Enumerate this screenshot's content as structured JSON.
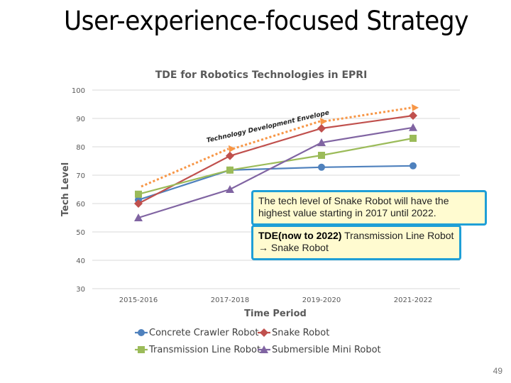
{
  "slide": {
    "title": "User-experience-focused Strategy",
    "page_number": "49"
  },
  "callouts": {
    "first": "The tech level of Snake Robot will have the highest value starting in 2017 until 2022.",
    "second_bold": "TDE(now to 2022)",
    "second_rest": " Transmission Line Robot → Snake Robot"
  },
  "chart_data": {
    "type": "line",
    "title": "TDE for Robotics Technologies in EPRI",
    "xlabel": "Time Period",
    "ylabel": "Tech Level",
    "categories": [
      "2015-2016",
      "2017-2018",
      "2019-2020",
      "2021-2022"
    ],
    "ylim": [
      30,
      100
    ],
    "yticks": [
      30,
      40,
      50,
      60,
      70,
      80,
      90,
      100
    ],
    "grid": true,
    "legend_position": "bottom",
    "series": [
      {
        "name": "Concrete Crawler Robot",
        "color": "#4f81bd",
        "marker": "circle",
        "values": [
          61.3,
          71.8,
          72.8,
          73.3
        ]
      },
      {
        "name": "Snake Robot",
        "color": "#c0504d",
        "marker": "diamond",
        "values": [
          60.0,
          76.8,
          86.5,
          91.0
        ]
      },
      {
        "name": "Transmission Line Robot",
        "color": "#9bbb59",
        "marker": "square",
        "values": [
          63.3,
          71.8,
          77.0,
          83.0
        ]
      },
      {
        "name": "Submersible Mini Robot",
        "color": "#8064a2",
        "marker": "triangle",
        "values": [
          55.0,
          65.0,
          81.5,
          86.8
        ]
      }
    ],
    "annotations": [
      {
        "type": "dotted-arrow",
        "label": "Technology Development Envelope",
        "color": "#f79646",
        "values": [
          66.0,
          79.3,
          89.0,
          93.8
        ]
      }
    ]
  }
}
